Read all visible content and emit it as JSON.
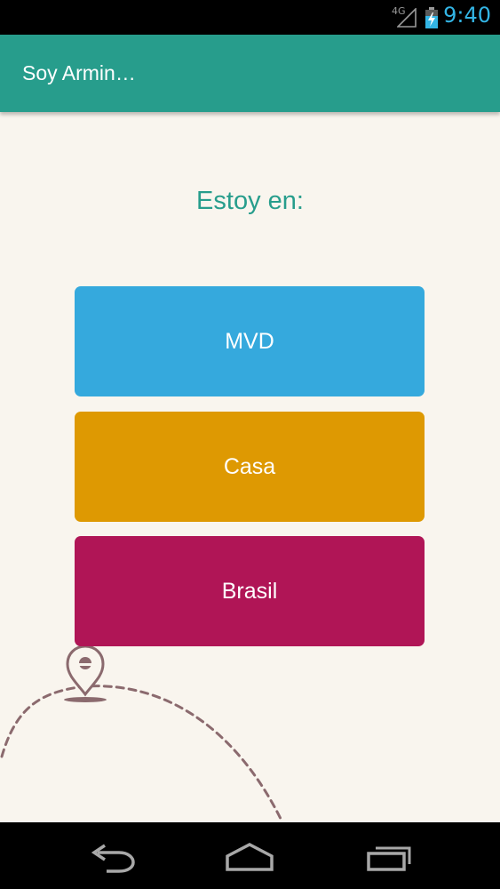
{
  "status_bar": {
    "network": "4G",
    "time": "9:40"
  },
  "action_bar": {
    "title": "Soy Armin…"
  },
  "main": {
    "heading": "Estoy en:",
    "buttons": [
      {
        "label": "MVD",
        "color": "#35a9dd"
      },
      {
        "label": "Casa",
        "color": "#de9902"
      },
      {
        "label": "Brasil",
        "color": "#b01556"
      }
    ]
  },
  "colors": {
    "accent": "#279d8c",
    "background": "#f9f5ee",
    "clock": "#33b5e5",
    "path": "#8b6a6e"
  },
  "icons": {
    "location": "map-pin-icon",
    "back": "back-arrow-icon",
    "home": "home-icon",
    "recent": "recent-apps-icon"
  }
}
